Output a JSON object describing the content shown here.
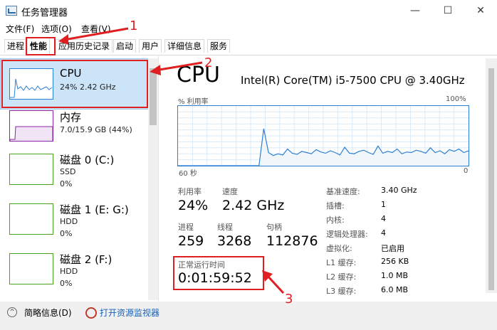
{
  "window": {
    "title": "任务管理器",
    "min": "—",
    "max": "☐",
    "close": "✕"
  },
  "menu": [
    "文件(F)",
    "选项(O)",
    "查看(V)"
  ],
  "tabs": [
    "进程",
    "性能",
    "应用历史记录",
    "启动",
    "用户",
    "详细信息",
    "服务"
  ],
  "left": {
    "cpu": {
      "title": "CPU",
      "sub": "24%  2.42 GHz"
    },
    "memory": {
      "title": "内存",
      "sub": "7.0/15.9 GB (44%)"
    },
    "disk0": {
      "title": "磁盘 0 (C:)",
      "type": "SSD",
      "usage": "0%"
    },
    "disk1": {
      "title": "磁盘 1 (E: G:)",
      "type": "HDD",
      "usage": "0%"
    },
    "disk2": {
      "title": "磁盘 2 (F:)",
      "type": "HDD",
      "usage": "0%"
    }
  },
  "main": {
    "heading": "CPU",
    "model": "Intel(R) Core(TM) i5-7500 CPU @ 3.40GHz",
    "graph_label": "% 利用率",
    "graph_max": "100%",
    "time_left": "60 秒",
    "time_right": "0",
    "stats": {
      "util_label": "利用率",
      "util_value": "24%",
      "speed_label": "速度",
      "speed_value": "2.42 GHz",
      "proc_label": "进程",
      "proc_value": "259",
      "thread_label": "线程",
      "thread_value": "3268",
      "handle_label": "句柄",
      "handle_value": "112876",
      "uptime_label": "正常运行时间",
      "uptime_value": "0:01:59:52"
    },
    "details": [
      {
        "k": "基准速度:",
        "v": "3.40 GHz"
      },
      {
        "k": "插槽:",
        "v": "1"
      },
      {
        "k": "内核:",
        "v": "4"
      },
      {
        "k": "逻辑处理器:",
        "v": "4"
      },
      {
        "k": "虚拟化:",
        "v": "已启用"
      },
      {
        "k": "L1 缓存:",
        "v": "256 KB"
      },
      {
        "k": "L2 缓存:",
        "v": "1.0 MB"
      },
      {
        "k": "L3 缓存:",
        "v": "6.0 MB"
      }
    ],
    "cpu_history": [
      0,
      0,
      0,
      0,
      0,
      0,
      0,
      0,
      0,
      0,
      0,
      0,
      0,
      0,
      0,
      0,
      0,
      0,
      62,
      22,
      17,
      20,
      18,
      28,
      21,
      19,
      24,
      22,
      20,
      27,
      23,
      21,
      25,
      22,
      18,
      31,
      21,
      20,
      24,
      26,
      22,
      19,
      33,
      21,
      24,
      22,
      28,
      20,
      23,
      22,
      26,
      24,
      21,
      30,
      22,
      25,
      20,
      27,
      24,
      28,
      22,
      25
    ]
  },
  "footer": {
    "summary": "简略信息(D)",
    "monitor": "打开资源监视器"
  },
  "annotations": [
    "1",
    "2",
    "3"
  ],
  "colors": {
    "accent": "#2b7fd4",
    "memory": "#8b25a8",
    "disk": "#4aa31c",
    "annotation": "#e02020"
  }
}
